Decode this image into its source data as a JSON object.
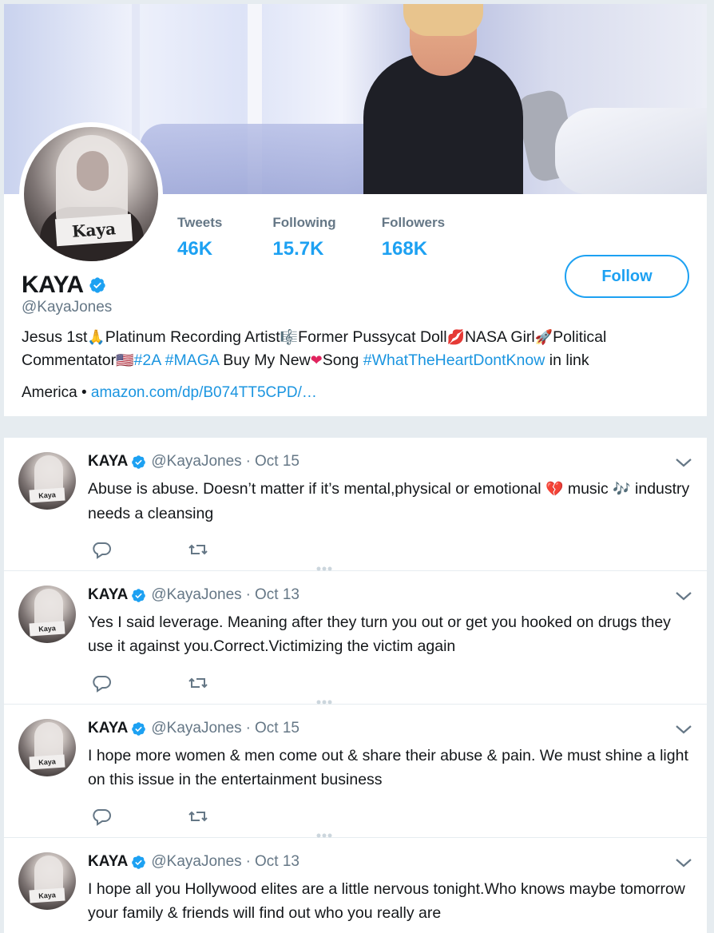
{
  "profile": {
    "name": "KAYA",
    "handle": "@KayaJones",
    "avatar_sign": "Kaya",
    "stats": [
      {
        "label": "Tweets",
        "value": "46K"
      },
      {
        "label": "Following",
        "value": "15.7K"
      },
      {
        "label": "Followers",
        "value": "168K"
      }
    ],
    "follow_label": "Follow",
    "bio": {
      "p1": "Jesus 1st",
      "e1": "🙏",
      "p2": "Platinum Recording Artist",
      "e2": "🎼",
      "p3": "Former Pussycat Doll",
      "e3": "💋",
      "p4": "NASA Girl",
      "e4": "🚀",
      "p5": "Political Commentator",
      "e5": "🇺🇸",
      "tag1": "#2A",
      "tag2": "#MAGA",
      "p6": " Buy My New",
      "e6": "❤",
      "p7": "Song ",
      "tag3": "#WhatTheHeartDontKnow",
      "p8": " in link"
    },
    "location": "America",
    "bullet": "•",
    "website": "amazon.com/dp/B074TT5CPD/…"
  },
  "tweets": [
    {
      "name": "KAYA",
      "handle": "@KayaJones",
      "dot": "·",
      "time": "Oct 15",
      "text_a": "Abuse is abuse. Doesn’t matter if it’s mental,physical or emotional ",
      "emoji_a": "💔",
      "text_b": " music ",
      "emoji_b": "🎶",
      "text_c": " industry needs a cleansing"
    },
    {
      "name": "KAYA",
      "handle": "@KayaJones",
      "dot": "·",
      "time": "Oct 13",
      "text": "Yes I said leverage. Meaning after they turn you out or get you hooked on drugs they use it against you.Correct.Victimizing the victim again"
    },
    {
      "name": "KAYA",
      "handle": "@KayaJones",
      "dot": "·",
      "time": "Oct 15",
      "text": "I hope more women & men come out & share their abuse & pain. We must shine a light on this issue in the entertainment business"
    },
    {
      "name": "KAYA",
      "handle": "@KayaJones",
      "dot": "·",
      "time": "Oct 13",
      "text": "I hope all you Hollywood elites are a little nervous tonight.Who knows maybe tomorrow your family & friends will find out who you really are"
    }
  ],
  "colors": {
    "accent": "#1da1f2",
    "link": "#1b95e0",
    "muted": "#657786",
    "background": "#e6ecf0"
  }
}
